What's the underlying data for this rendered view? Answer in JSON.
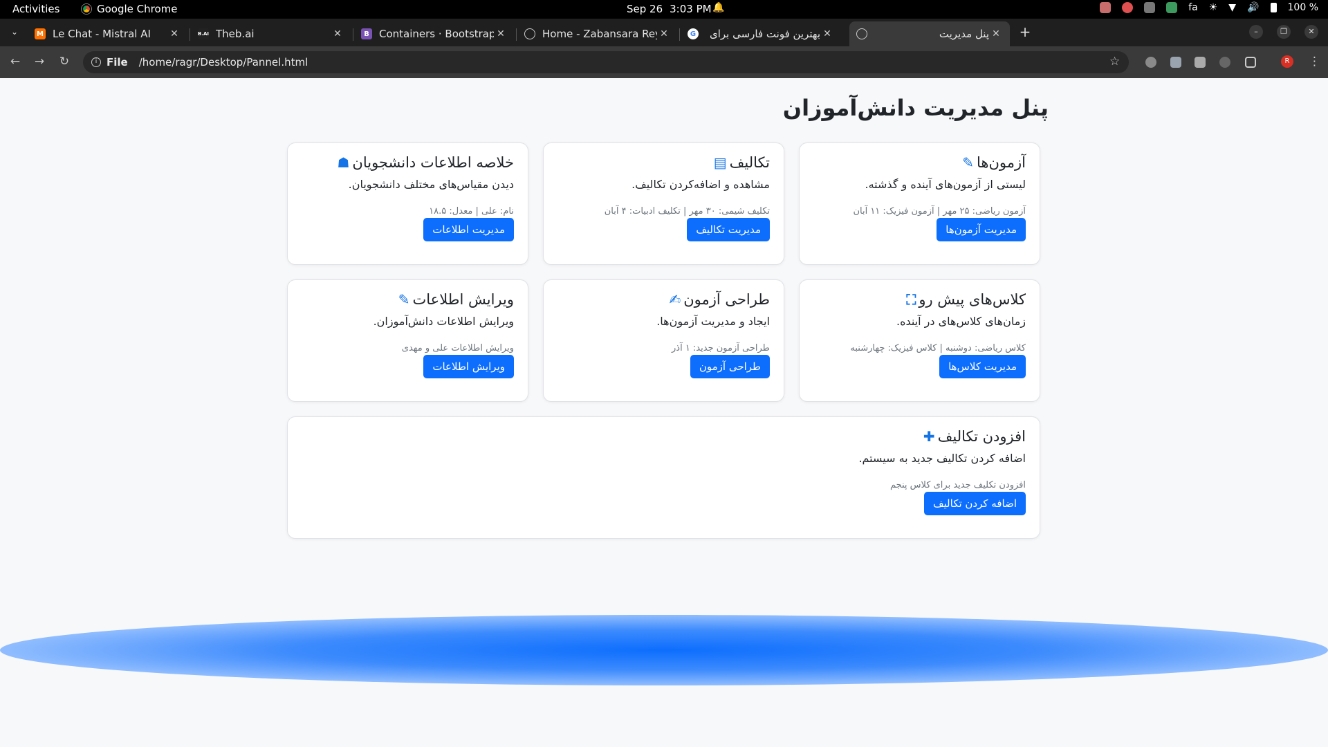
{
  "system_bar": {
    "activities": "Activities",
    "app_name": "Google Chrome",
    "date": "Sep 26",
    "time": "3:03 PM",
    "keyboard_layout": "fa",
    "battery": "100 %"
  },
  "browser": {
    "tabs": [
      {
        "title": "Le Chat - Mistral AI",
        "favicon": "mistral-icon",
        "active": false
      },
      {
        "title": "Theb.ai",
        "favicon": "theb-icon",
        "active": false
      },
      {
        "title": "Containers · Bootstrap v",
        "favicon": "bootstrap-icon",
        "active": false
      },
      {
        "title": "Home - Zabansara Rey R",
        "favicon": "globe-icon",
        "active": false
      },
      {
        "title": "بهترین فونت فارسی برای",
        "favicon": "google-icon",
        "active": false
      },
      {
        "title": "پنل مدیریت",
        "favicon": "globe-icon",
        "active": true
      }
    ],
    "address": {
      "scheme": "File",
      "path": "/home/ragr/Desktop/Pannel.html"
    }
  },
  "page": {
    "title": "پنل مدیریت دانش‌آموزان",
    "accent_color": "#0d6efd",
    "cards": [
      {
        "title": "آزمون‌ها",
        "icon": "pencil-icon",
        "description": "لیستی از آزمون‌های آینده و گذشته.",
        "meta": "آزمون ریاضی: ۲۵ مهر | آزمون فیزیک: ۱۱ آبان",
        "button": "مدیریت آزمون‌ها"
      },
      {
        "title": "تکالیف",
        "icon": "journal-icon",
        "description": "مشاهده و اضافه‌کردن تکالیف.",
        "meta": "تکلیف شیمی: ۳۰ مهر | تکلیف ادبیات: ۴ آبان",
        "button": "مدیریت تکالیف"
      },
      {
        "title": "خلاصه اطلاعات دانشجویان",
        "icon": "student-icon",
        "description": "دیدن مقیاس‌های مختلف دانشجویان.",
        "meta": "نام: علی | معدل: ۱۸.۵",
        "button": "مدیریت اطلاعات"
      },
      {
        "title": "کلاس‌های پیش رو",
        "icon": "classroom-icon",
        "description": "زمان‌های کلاس‌های در آینده.",
        "meta": "کلاس ریاضی: دوشنبه | کلاس فیزیک: چهارشنبه",
        "button": "مدیریت کلاس‌ها"
      },
      {
        "title": "طراحی آزمون",
        "icon": "edit-square-icon",
        "description": "ایجاد و مدیریت آزمون‌ها.",
        "meta": "طراحی آزمون جدید: ۱ آذر",
        "button": "طراحی آزمون"
      },
      {
        "title": "ویرایش اطلاعات",
        "icon": "pencil-icon",
        "description": "ویرایش اطلاعات دانش‌آموزان.",
        "meta": "ویرایش اطلاعات علی و مهدی",
        "button": "ویرایش اطلاعات"
      },
      {
        "title": "افزودن تکالیف",
        "icon": "plus-icon",
        "description": "اضافه کردن تکالیف جدید به سیستم.",
        "meta": "افزودن تکلیف جدید برای کلاس پنجم",
        "button": "اضافه کردن تکالیف"
      }
    ]
  }
}
